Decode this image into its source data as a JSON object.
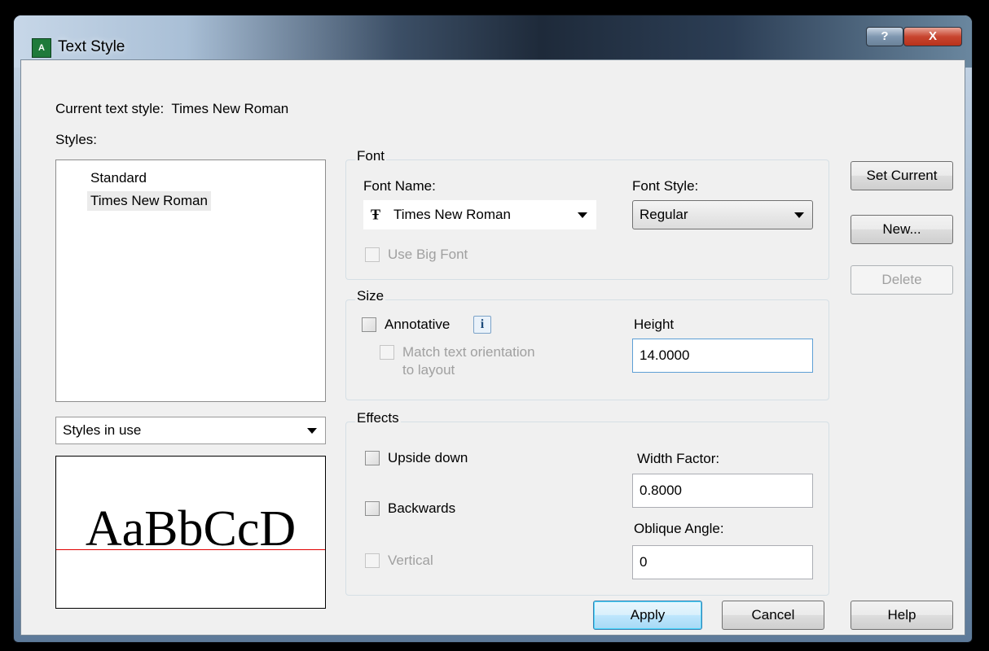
{
  "window": {
    "title": "Text Style",
    "help_button": "?",
    "close_button": "X",
    "app_icon": "AutoCAD-icon"
  },
  "header": {
    "current_style_label": "Current text style:",
    "current_style_value": "Times New Roman",
    "styles_label": "Styles:"
  },
  "styles": {
    "items": [
      {
        "label": "Standard",
        "selected": false
      },
      {
        "label": "Times New Roman",
        "selected": true
      }
    ]
  },
  "filter": {
    "value": "Styles in use"
  },
  "preview": {
    "sample_text": "AaBbCcD",
    "baseline_color": "#e00000"
  },
  "font": {
    "group_title": "Font",
    "name_label": "Font Name:",
    "name_value": "Times New Roman",
    "truetype_icon": "truetype-icon",
    "style_label": "Font Style:",
    "style_value": "Regular",
    "big_font_label": "Use Big Font"
  },
  "size": {
    "group_title": "Size",
    "annotative_label": "Annotative",
    "info_glyph": "i",
    "match_line1": "Match text orientation",
    "match_line2": "to layout",
    "height_label": "Height",
    "height_value": "14.0000"
  },
  "effects": {
    "group_title": "Effects",
    "upside_down_label": "Upside down",
    "backwards_label": "Backwards",
    "vertical_label": "Vertical",
    "width_factor_label": "Width Factor:",
    "width_factor_value": "0.8000",
    "oblique_label": "Oblique Angle:",
    "oblique_value": "0"
  },
  "side_buttons": {
    "set_current": "Set Current",
    "new": "New...",
    "delete": "Delete"
  },
  "footer": {
    "apply": "Apply",
    "cancel": "Cancel",
    "help": "Help"
  }
}
